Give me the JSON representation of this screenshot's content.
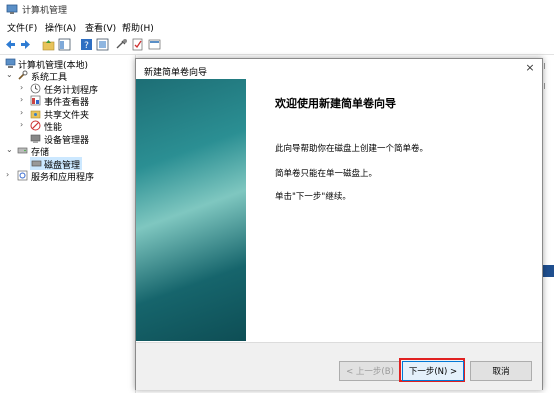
{
  "window": {
    "title": "计算机管理"
  },
  "menu": [
    "文件(F)",
    "操作(A)",
    "查看(V)",
    "帮助(H)"
  ],
  "toolbar_icons": [
    "back-arrow-icon",
    "forward-arrow-icon",
    "folder-up-icon",
    "tree-view-icon",
    "help-icon",
    "view-icon",
    "connect-icon",
    "checklist-icon",
    "properties-icon"
  ],
  "tree": {
    "root": "计算机管理(本地)",
    "system_tools": "系统工具",
    "task_scheduler": "任务计划程序",
    "event_viewer": "事件查看器",
    "shared_folders": "共享文件夹",
    "performance": "性能",
    "device_manager": "设备管理器",
    "storage": "存储",
    "disk_management": "磁盘管理",
    "services_apps": "服务和应用程序"
  },
  "dialog": {
    "title": "新建简单卷向导",
    "close": "×",
    "heading": "欢迎使用新建简单卷向导",
    "line1": "此向导帮助你在磁盘上创建一个简单卷。",
    "line2": "简单卷只能在单一磁盘上。",
    "line3": "单击\"下一步\"继续。",
    "back_label": "< 上一步(B)",
    "next_label": "下一步(N) >",
    "cancel_label": "取消"
  },
  "colors": {
    "selection": "#cce8ff",
    "highlight": "#e02020",
    "accent": "#0078d7"
  }
}
